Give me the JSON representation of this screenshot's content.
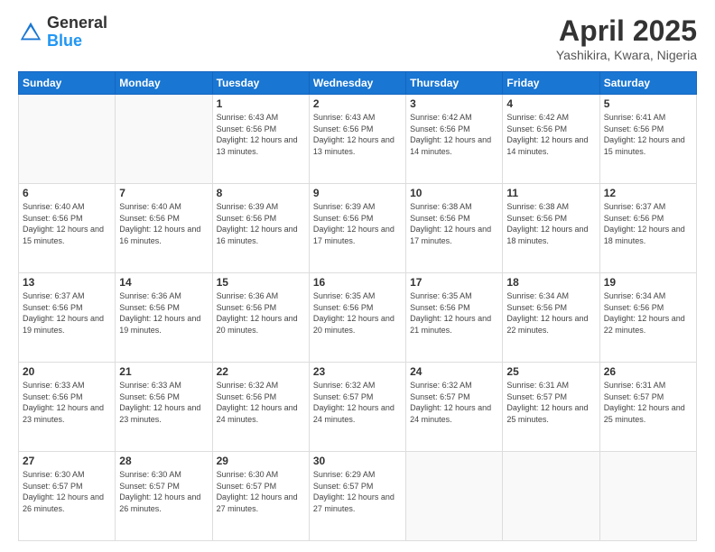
{
  "header": {
    "logo_general": "General",
    "logo_blue": "Blue",
    "title": "April 2025",
    "location": "Yashikira, Kwara, Nigeria"
  },
  "weekdays": [
    "Sunday",
    "Monday",
    "Tuesday",
    "Wednesday",
    "Thursday",
    "Friday",
    "Saturday"
  ],
  "weeks": [
    [
      {
        "day": "",
        "sunrise": "",
        "sunset": "",
        "daylight": "",
        "empty": true
      },
      {
        "day": "",
        "sunrise": "",
        "sunset": "",
        "daylight": "",
        "empty": true
      },
      {
        "day": "1",
        "sunrise": "Sunrise: 6:43 AM",
        "sunset": "Sunset: 6:56 PM",
        "daylight": "Daylight: 12 hours and 13 minutes.",
        "empty": false
      },
      {
        "day": "2",
        "sunrise": "Sunrise: 6:43 AM",
        "sunset": "Sunset: 6:56 PM",
        "daylight": "Daylight: 12 hours and 13 minutes.",
        "empty": false
      },
      {
        "day": "3",
        "sunrise": "Sunrise: 6:42 AM",
        "sunset": "Sunset: 6:56 PM",
        "daylight": "Daylight: 12 hours and 14 minutes.",
        "empty": false
      },
      {
        "day": "4",
        "sunrise": "Sunrise: 6:42 AM",
        "sunset": "Sunset: 6:56 PM",
        "daylight": "Daylight: 12 hours and 14 minutes.",
        "empty": false
      },
      {
        "day": "5",
        "sunrise": "Sunrise: 6:41 AM",
        "sunset": "Sunset: 6:56 PM",
        "daylight": "Daylight: 12 hours and 15 minutes.",
        "empty": false
      }
    ],
    [
      {
        "day": "6",
        "sunrise": "Sunrise: 6:40 AM",
        "sunset": "Sunset: 6:56 PM",
        "daylight": "Daylight: 12 hours and 15 minutes.",
        "empty": false
      },
      {
        "day": "7",
        "sunrise": "Sunrise: 6:40 AM",
        "sunset": "Sunset: 6:56 PM",
        "daylight": "Daylight: 12 hours and 16 minutes.",
        "empty": false
      },
      {
        "day": "8",
        "sunrise": "Sunrise: 6:39 AM",
        "sunset": "Sunset: 6:56 PM",
        "daylight": "Daylight: 12 hours and 16 minutes.",
        "empty": false
      },
      {
        "day": "9",
        "sunrise": "Sunrise: 6:39 AM",
        "sunset": "Sunset: 6:56 PM",
        "daylight": "Daylight: 12 hours and 17 minutes.",
        "empty": false
      },
      {
        "day": "10",
        "sunrise": "Sunrise: 6:38 AM",
        "sunset": "Sunset: 6:56 PM",
        "daylight": "Daylight: 12 hours and 17 minutes.",
        "empty": false
      },
      {
        "day": "11",
        "sunrise": "Sunrise: 6:38 AM",
        "sunset": "Sunset: 6:56 PM",
        "daylight": "Daylight: 12 hours and 18 minutes.",
        "empty": false
      },
      {
        "day": "12",
        "sunrise": "Sunrise: 6:37 AM",
        "sunset": "Sunset: 6:56 PM",
        "daylight": "Daylight: 12 hours and 18 minutes.",
        "empty": false
      }
    ],
    [
      {
        "day": "13",
        "sunrise": "Sunrise: 6:37 AM",
        "sunset": "Sunset: 6:56 PM",
        "daylight": "Daylight: 12 hours and 19 minutes.",
        "empty": false
      },
      {
        "day": "14",
        "sunrise": "Sunrise: 6:36 AM",
        "sunset": "Sunset: 6:56 PM",
        "daylight": "Daylight: 12 hours and 19 minutes.",
        "empty": false
      },
      {
        "day": "15",
        "sunrise": "Sunrise: 6:36 AM",
        "sunset": "Sunset: 6:56 PM",
        "daylight": "Daylight: 12 hours and 20 minutes.",
        "empty": false
      },
      {
        "day": "16",
        "sunrise": "Sunrise: 6:35 AM",
        "sunset": "Sunset: 6:56 PM",
        "daylight": "Daylight: 12 hours and 20 minutes.",
        "empty": false
      },
      {
        "day": "17",
        "sunrise": "Sunrise: 6:35 AM",
        "sunset": "Sunset: 6:56 PM",
        "daylight": "Daylight: 12 hours and 21 minutes.",
        "empty": false
      },
      {
        "day": "18",
        "sunrise": "Sunrise: 6:34 AM",
        "sunset": "Sunset: 6:56 PM",
        "daylight": "Daylight: 12 hours and 22 minutes.",
        "empty": false
      },
      {
        "day": "19",
        "sunrise": "Sunrise: 6:34 AM",
        "sunset": "Sunset: 6:56 PM",
        "daylight": "Daylight: 12 hours and 22 minutes.",
        "empty": false
      }
    ],
    [
      {
        "day": "20",
        "sunrise": "Sunrise: 6:33 AM",
        "sunset": "Sunset: 6:56 PM",
        "daylight": "Daylight: 12 hours and 23 minutes.",
        "empty": false
      },
      {
        "day": "21",
        "sunrise": "Sunrise: 6:33 AM",
        "sunset": "Sunset: 6:56 PM",
        "daylight": "Daylight: 12 hours and 23 minutes.",
        "empty": false
      },
      {
        "day": "22",
        "sunrise": "Sunrise: 6:32 AM",
        "sunset": "Sunset: 6:56 PM",
        "daylight": "Daylight: 12 hours and 24 minutes.",
        "empty": false
      },
      {
        "day": "23",
        "sunrise": "Sunrise: 6:32 AM",
        "sunset": "Sunset: 6:57 PM",
        "daylight": "Daylight: 12 hours and 24 minutes.",
        "empty": false
      },
      {
        "day": "24",
        "sunrise": "Sunrise: 6:32 AM",
        "sunset": "Sunset: 6:57 PM",
        "daylight": "Daylight: 12 hours and 24 minutes.",
        "empty": false
      },
      {
        "day": "25",
        "sunrise": "Sunrise: 6:31 AM",
        "sunset": "Sunset: 6:57 PM",
        "daylight": "Daylight: 12 hours and 25 minutes.",
        "empty": false
      },
      {
        "day": "26",
        "sunrise": "Sunrise: 6:31 AM",
        "sunset": "Sunset: 6:57 PM",
        "daylight": "Daylight: 12 hours and 25 minutes.",
        "empty": false
      }
    ],
    [
      {
        "day": "27",
        "sunrise": "Sunrise: 6:30 AM",
        "sunset": "Sunset: 6:57 PM",
        "daylight": "Daylight: 12 hours and 26 minutes.",
        "empty": false
      },
      {
        "day": "28",
        "sunrise": "Sunrise: 6:30 AM",
        "sunset": "Sunset: 6:57 PM",
        "daylight": "Daylight: 12 hours and 26 minutes.",
        "empty": false
      },
      {
        "day": "29",
        "sunrise": "Sunrise: 6:30 AM",
        "sunset": "Sunset: 6:57 PM",
        "daylight": "Daylight: 12 hours and 27 minutes.",
        "empty": false
      },
      {
        "day": "30",
        "sunrise": "Sunrise: 6:29 AM",
        "sunset": "Sunset: 6:57 PM",
        "daylight": "Daylight: 12 hours and 27 minutes.",
        "empty": false
      },
      {
        "day": "",
        "sunrise": "",
        "sunset": "",
        "daylight": "",
        "empty": true
      },
      {
        "day": "",
        "sunrise": "",
        "sunset": "",
        "daylight": "",
        "empty": true
      },
      {
        "day": "",
        "sunrise": "",
        "sunset": "",
        "daylight": "",
        "empty": true
      }
    ]
  ]
}
